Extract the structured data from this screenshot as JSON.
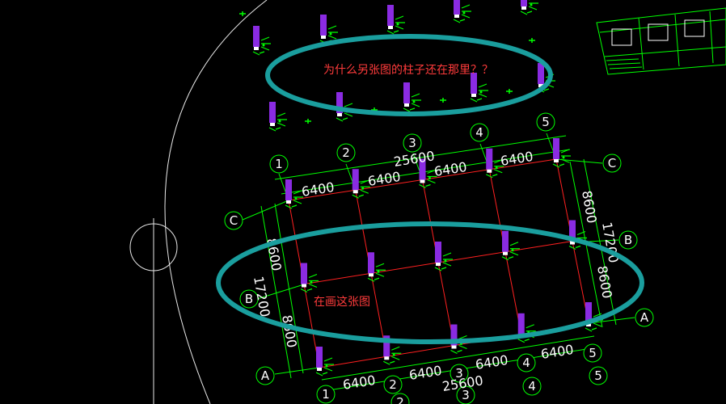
{
  "colors": {
    "background": "#000000",
    "grid_line": "#ff2020",
    "dim_line": "#00ff00",
    "column": "#8a2be2",
    "highlight_ellipse": "#1a9e9e",
    "annotation": "#ff3b3b",
    "axis_bubble": "#00ff00",
    "text": "#ffffff"
  },
  "annotations": {
    "top_note": "为什么另张图的柱子还在那里？？",
    "bottom_note": "在画这张图"
  },
  "axis_labels": {
    "numbers": [
      "1",
      "2",
      "3",
      "4",
      "5"
    ],
    "letters": [
      "A",
      "B",
      "C"
    ]
  },
  "dimensions": {
    "bay_width": "6400",
    "total_width": "25600",
    "bay_depth": "8600",
    "total_depth": "17200"
  },
  "icons": {
    "column": "column-icon",
    "axis_bubble": "axis-bubble-icon",
    "circle_symbol": "circle-symbol-icon"
  }
}
